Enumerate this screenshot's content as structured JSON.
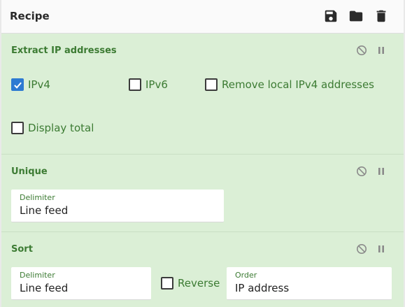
{
  "recipe": {
    "title": "Recipe",
    "icons": [
      "save-icon",
      "folder-icon",
      "trash-icon"
    ]
  },
  "operations": [
    {
      "name": "Extract IP addresses",
      "checkboxes": [
        {
          "label": "IPv4",
          "checked": true
        },
        {
          "label": "IPv6",
          "checked": false
        },
        {
          "label": "Remove local IPv4 addresses",
          "checked": false
        },
        {
          "label": "Display total",
          "checked": false
        }
      ]
    },
    {
      "name": "Unique",
      "fields": [
        {
          "label": "Delimiter",
          "value": "Line feed"
        }
      ]
    },
    {
      "name": "Sort",
      "fields": [
        {
          "label": "Delimiter",
          "value": "Line feed"
        },
        {
          "label": "Order",
          "value": "IP address"
        }
      ],
      "checkboxes": [
        {
          "label": "Reverse",
          "checked": false
        }
      ]
    }
  ],
  "colors": {
    "op_background": "#dbefd6",
    "op_text": "#3c7b33",
    "checkbox_checked": "#2d7ad2"
  }
}
